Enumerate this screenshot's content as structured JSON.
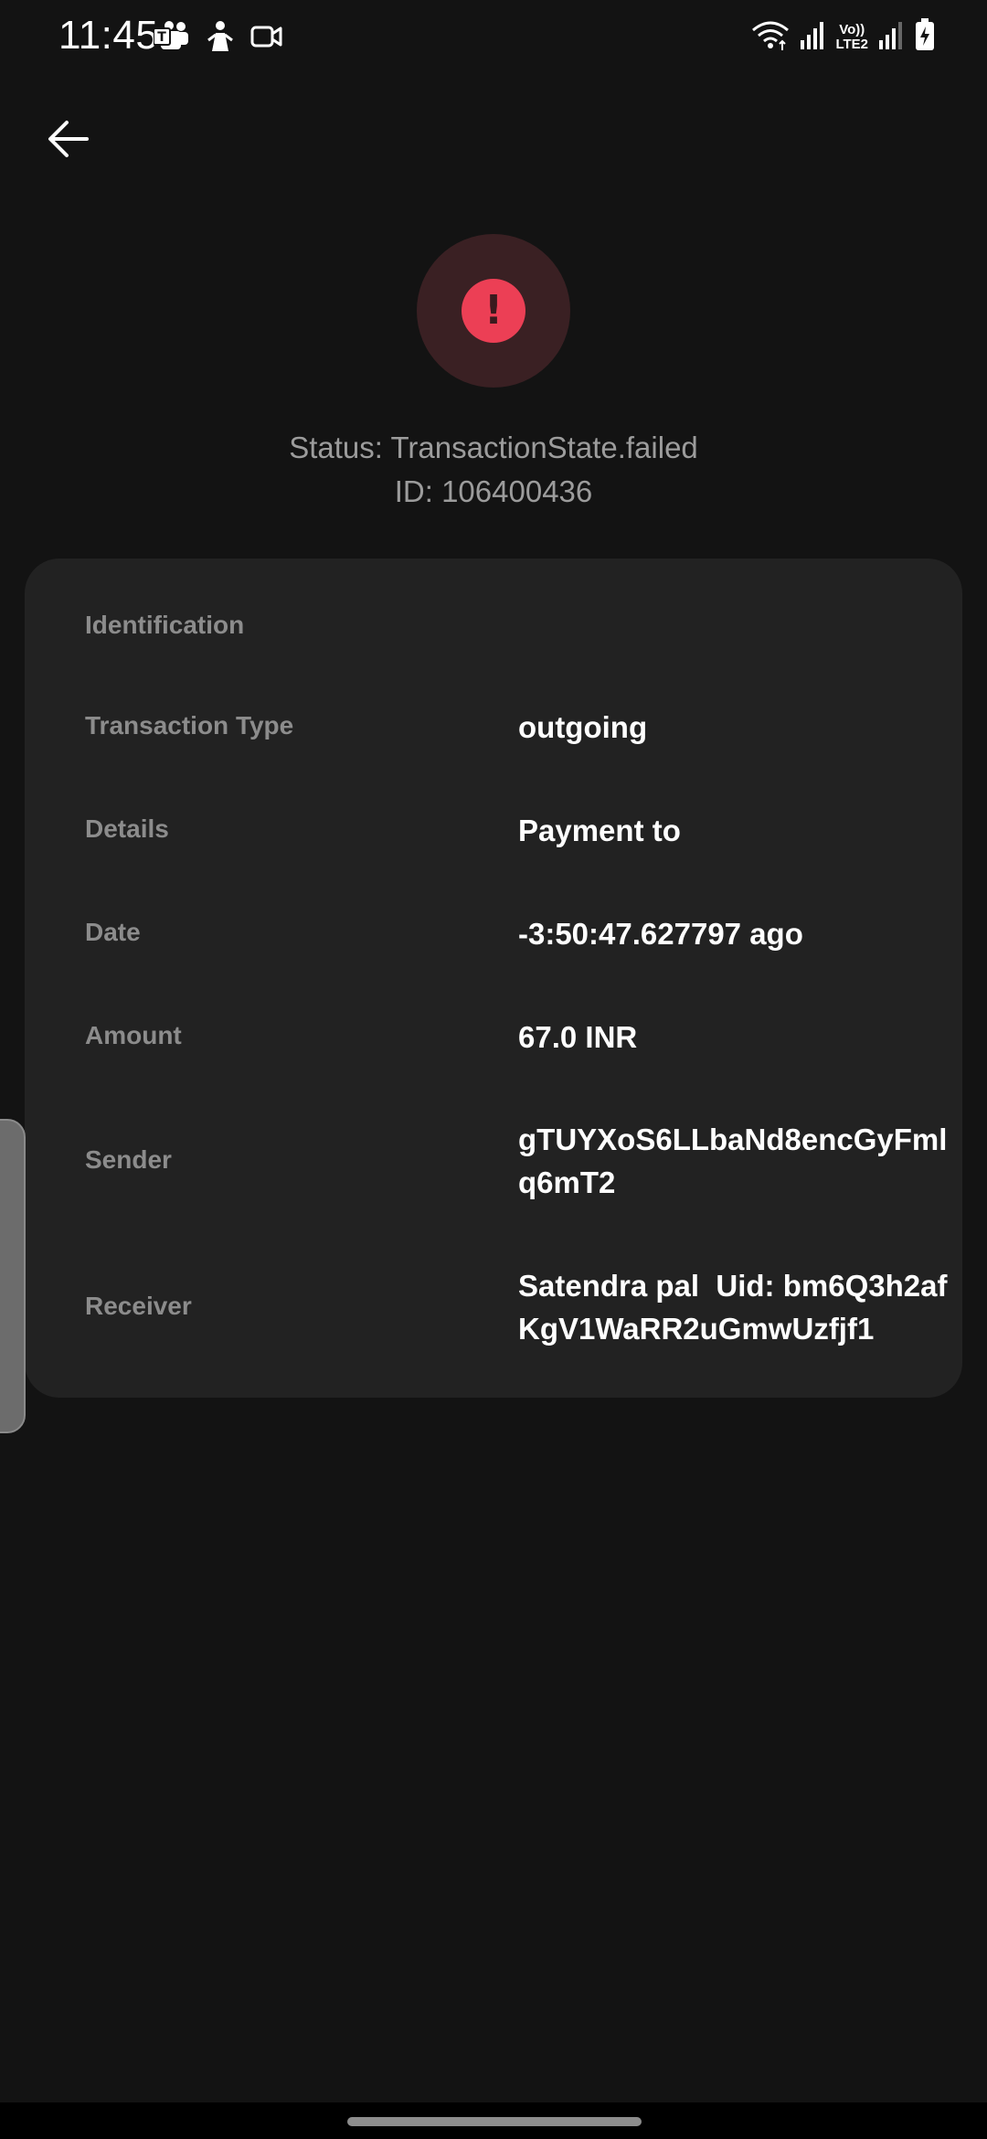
{
  "status_bar": {
    "time": "11:45",
    "left_icons": [
      "teams-icon",
      "notification-icon",
      "video-icon"
    ],
    "right_icons": [
      "wifi-icon",
      "signal-icon",
      "volte-lte2-icon",
      "signal-2-icon",
      "battery-charging-icon"
    ],
    "volte_label_top": "Vo))",
    "volte_label_bottom": "LTE2"
  },
  "header": {
    "back_icon": "arrow-left-icon",
    "status_icon": "exclamation-icon",
    "status_color": "#ec3f55",
    "status_line": "Status: TransactionState.failed",
    "id_line": "ID: 106400436"
  },
  "details": {
    "section_title": "Identification",
    "rows": [
      {
        "label": "Transaction Type",
        "value": "outgoing"
      },
      {
        "label": "Details",
        "value": "Payment to"
      },
      {
        "label": "Date",
        "value": "-3:50:47.627797 ago"
      },
      {
        "label": "Amount",
        "value": "67.0 INR"
      },
      {
        "label": "Sender",
        "value_line1": "gTUYXoS6LLbaNd8encGyFml",
        "value_line2": "q6mT2"
      },
      {
        "label": "Receiver",
        "value_line1": "Satendra pal  Uid: bm6Q3h2af",
        "value_line2": "KgV1WaRR2uGmwUzfjf1"
      }
    ]
  }
}
